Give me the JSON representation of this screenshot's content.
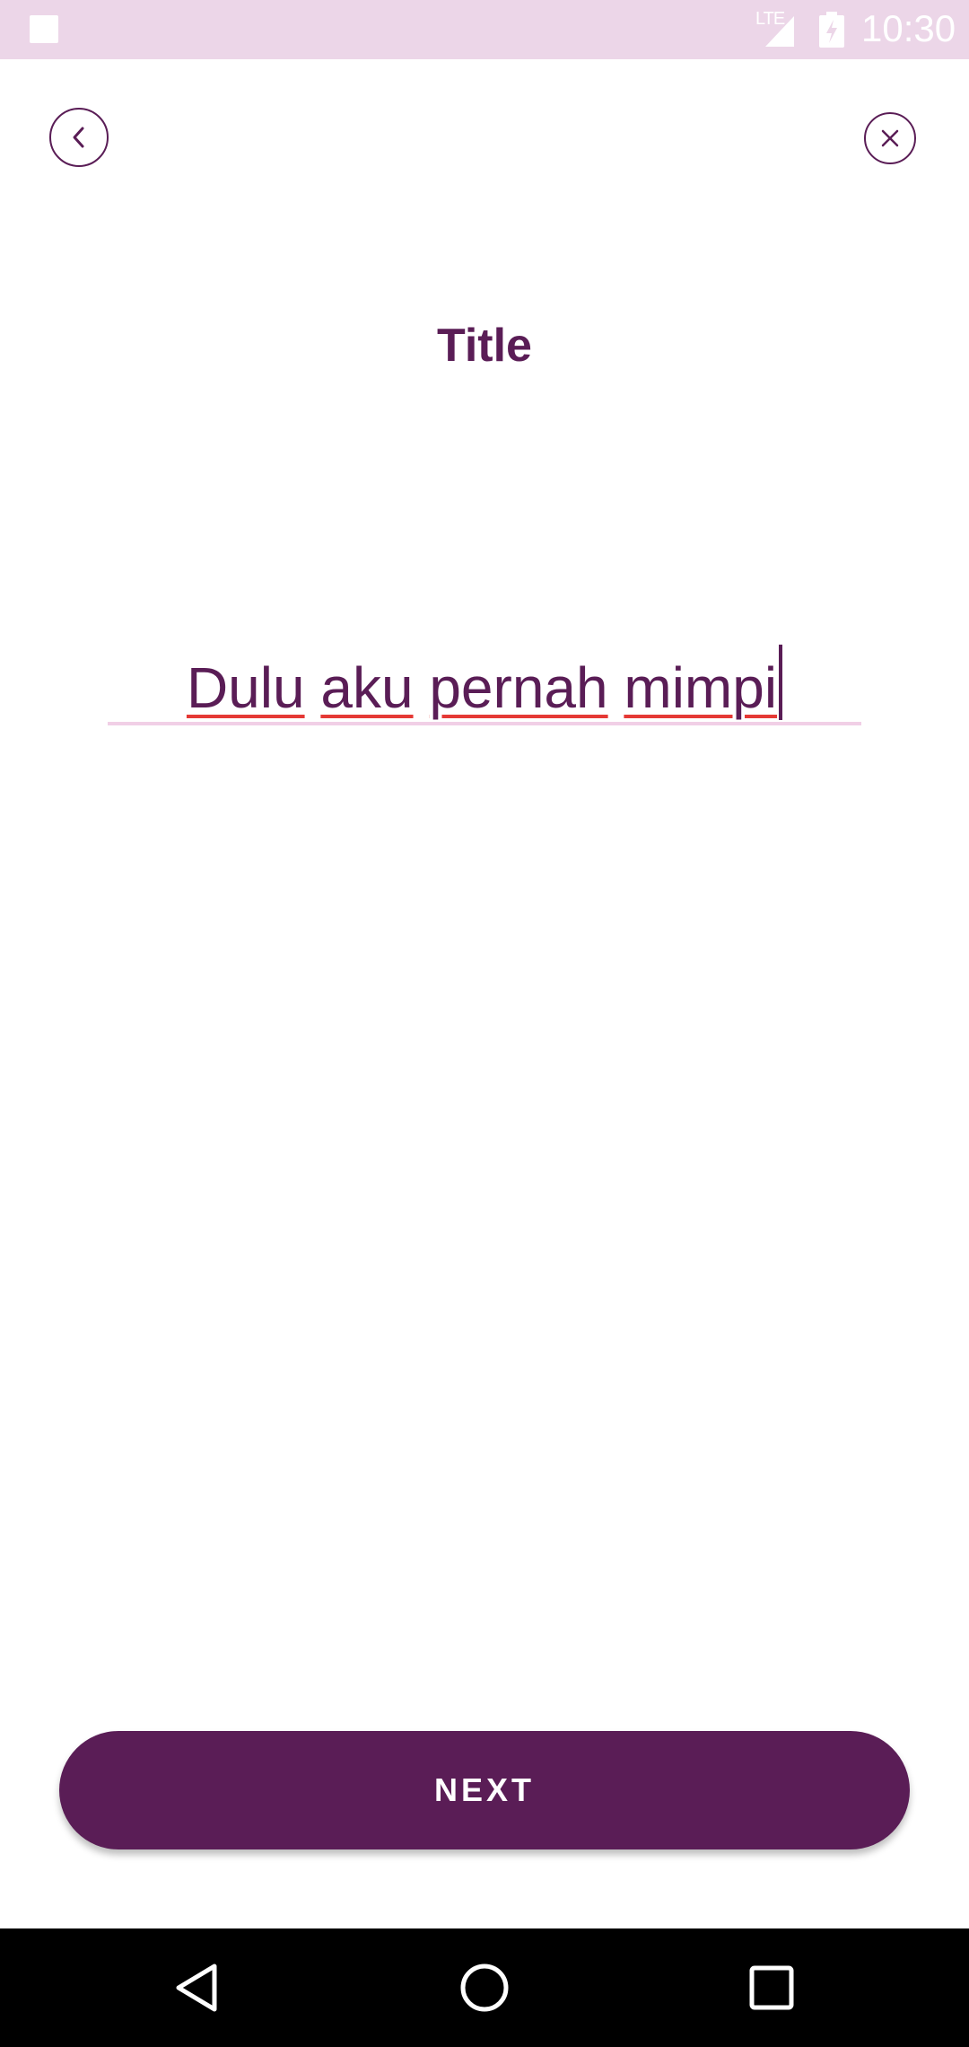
{
  "status_bar": {
    "time": "10:30",
    "network": "LTE",
    "icons": [
      "notification-icon",
      "signal-icon",
      "battery-charging-icon"
    ]
  },
  "header": {
    "back_icon": "chevron-left-icon",
    "close_icon": "close-icon"
  },
  "page": {
    "title": "Title"
  },
  "title_input": {
    "words": [
      "Dulu",
      "aku",
      "pernah",
      "mimpi"
    ]
  },
  "actions": {
    "next_label": "NEXT"
  },
  "nav_bar": {
    "icons": [
      "nav-back-icon",
      "nav-home-icon",
      "nav-recents-icon"
    ]
  },
  "colors": {
    "accent": "#5a1d56",
    "status_bar_bg": "#ecd6e8",
    "input_underline": "#f1cfe6",
    "spellcheck": "#e53935"
  }
}
